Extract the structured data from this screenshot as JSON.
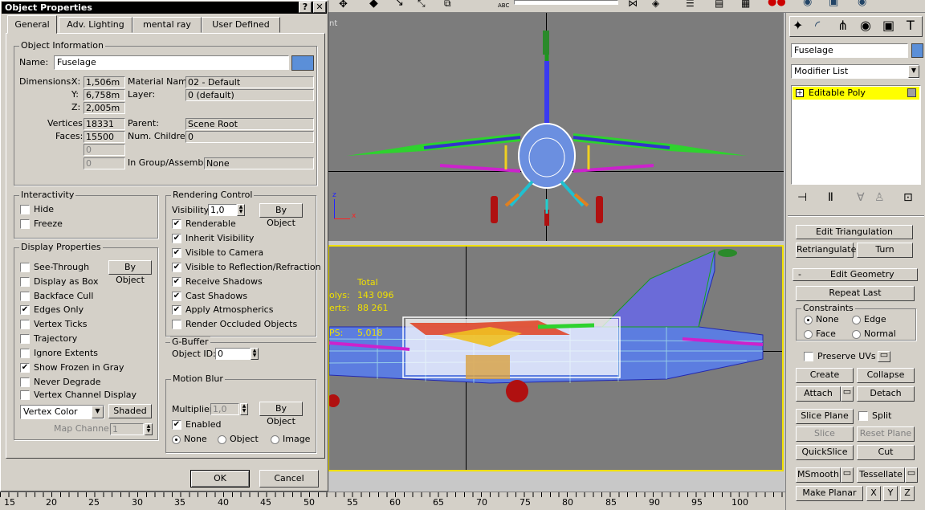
{
  "dialog": {
    "title": "Object Properties",
    "title_buttons": [
      "?",
      "✕"
    ],
    "tabs": [
      "General",
      "Adv. Lighting",
      "mental ray",
      "User Defined"
    ],
    "object_info": {
      "group_title": "Object Information",
      "name_label": "Name:",
      "name_value": "Fuselage",
      "swatch_color": "#5b8fd8",
      "dimensions_label": "Dimensions:",
      "x_label": "X:",
      "x_value": "1,506m",
      "y_label": "Y:",
      "y_value": "6,758m",
      "z_label": "Z:",
      "z_value": "2,005m",
      "vertices_label": "Vertices:",
      "vertices_value": "18331",
      "faces_label": "Faces:",
      "faces_value": "15500",
      "blank1": "0",
      "blank2": "0",
      "material_label": "Material Name:",
      "material_value": "02 - Default",
      "layer_label": "Layer:",
      "layer_value": "0 (default)",
      "parent_label": "Parent:",
      "parent_value": "Scene Root",
      "children_label": "Num. Children:",
      "children_value": "0",
      "group_label": "In Group/Assembly:",
      "group_value": "None"
    },
    "interactivity": {
      "title": "Interactivity",
      "hide": "Hide",
      "freeze": "Freeze"
    },
    "display_props": {
      "title": "Display Properties",
      "by_object": "By Object",
      "items": [
        {
          "label": "See-Through",
          "checked": ""
        },
        {
          "label": "Display as Box",
          "checked": ""
        },
        {
          "label": "Backface Cull",
          "checked": ""
        },
        {
          "label": "Edges Only",
          "checked": "✔"
        },
        {
          "label": "Vertex Ticks",
          "checked": ""
        },
        {
          "label": "Trajectory",
          "checked": ""
        },
        {
          "label": "Ignore Extents",
          "checked": ""
        },
        {
          "label": "Show Frozen in Gray",
          "checked": "✔"
        },
        {
          "label": "Never Degrade",
          "checked": ""
        },
        {
          "label": "Vertex Channel Display",
          "checked": ""
        }
      ],
      "vertex_color": "Vertex Color",
      "shaded": "Shaded",
      "map_channel_label": "Map Channel:",
      "map_channel_value": "1"
    },
    "rendering": {
      "title": "Rendering Control",
      "visibility_label": "Visibility:",
      "visibility_value": "1,0",
      "by_object": "By Object",
      "items": [
        {
          "label": "Renderable",
          "checked": "✔"
        },
        {
          "label": "Inherit Visibility",
          "checked": "✔"
        },
        {
          "label": "Visible to Camera",
          "checked": "✔"
        },
        {
          "label": "Visible to Reflection/Refraction",
          "checked": "✔"
        },
        {
          "label": "Receive Shadows",
          "checked": "✔"
        },
        {
          "label": "Cast Shadows",
          "checked": "✔"
        },
        {
          "label": "Apply Atmospherics",
          "checked": "✔"
        },
        {
          "label": "Render Occluded Objects",
          "checked": ""
        }
      ]
    },
    "gbuffer": {
      "title": "G-Buffer",
      "object_id_label": "Object ID:",
      "object_id_value": "0"
    },
    "motion_blur": {
      "title": "Motion Blur",
      "multiplier_label": "Multiplier:",
      "multiplier_value": "1,0",
      "by_object": "By Object",
      "enabled": "Enabled",
      "none": "None",
      "object": "Object",
      "image": "Image"
    },
    "ok": "OK",
    "cancel": "Cancel"
  },
  "viewport": {
    "stats_total": "Total",
    "stats_polys_label": "olys:",
    "stats_polys": "143 096",
    "stats_verts_label": "erts:",
    "stats_verts": "88 261",
    "stats_fps_label": "PS:",
    "stats_fps": "5,018",
    "axis_x": "x",
    "axis_z": "z",
    "corner_label": "nt"
  },
  "timeline": {
    "ticks": [
      "15",
      "20",
      "25",
      "30",
      "35",
      "40",
      "45",
      "50",
      "55",
      "60",
      "65",
      "70",
      "75",
      "80",
      "85",
      "90",
      "95",
      "100"
    ]
  },
  "command_panel": {
    "object_name": "Fuselage",
    "color": "#5b8fd8",
    "modifier_list": "Modifier List",
    "stack_item": "Editable Poly",
    "edit_triangulation": "Edit Triangulation",
    "retriangulate": "Retriangulate",
    "turn": "Turn",
    "edit_geometry": "Edit Geometry",
    "rollout_minus": "-",
    "repeat_last": "Repeat Last",
    "constraints": "Constraints",
    "none": "None",
    "edge": "Edge",
    "face": "Face",
    "normal": "Normal",
    "preserve_uvs": "Preserve UVs",
    "create": "Create",
    "collapse": "Collapse",
    "attach": "Attach",
    "detach": "Detach",
    "slice_plane": "Slice Plane",
    "split": "Split",
    "slice": "Slice",
    "reset_plane": "Reset Plane",
    "quickslice": "QuickSlice",
    "cut": "Cut",
    "msmooth": "MSmooth",
    "tessellate": "Tessellate",
    "make_planar": "Make Planar",
    "x": "X",
    "y": "Y",
    "z": "Z"
  },
  "toolbar": {
    "abc_label": "ABC"
  }
}
